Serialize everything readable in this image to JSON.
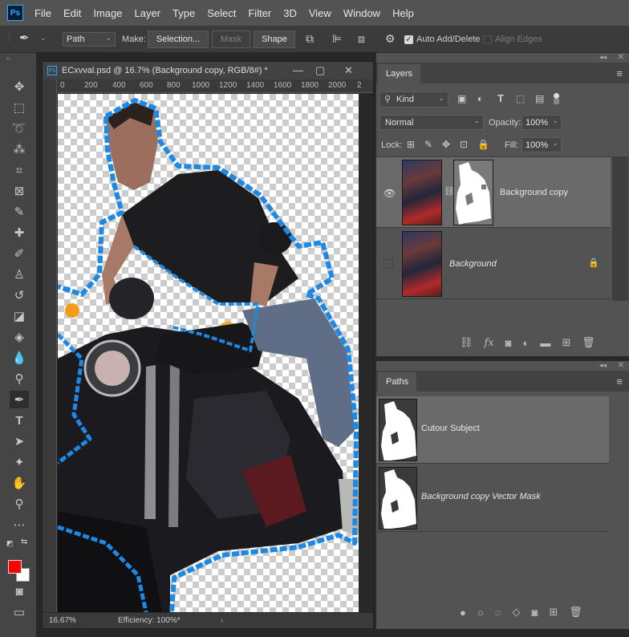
{
  "app": {
    "logo": "Ps"
  },
  "menu": [
    "File",
    "Edit",
    "Image",
    "Layer",
    "Type",
    "Select",
    "Filter",
    "3D",
    "View",
    "Window",
    "Help"
  ],
  "options": {
    "mode_value": "Path",
    "make_label": "Make:",
    "selection_btn": "Selection...",
    "mask_btn": "Mask",
    "shape_btn": "Shape",
    "auto_add_delete": "Auto Add/Delete",
    "align_edges": "Align Edges"
  },
  "tools": [
    "move-icon",
    "marquee-icon",
    "lasso-icon",
    "quick-select-icon",
    "crop-icon",
    "frame-icon",
    "eyedropper-icon",
    "healing-icon",
    "brush-icon",
    "stamp-icon",
    "history-brush-icon",
    "eraser-icon",
    "paint-bucket-icon",
    "blur-icon",
    "dodge-icon",
    "pen-icon",
    "type-icon",
    "path-select-icon",
    "custom-shape-icon",
    "hand-icon",
    "zoom-icon",
    "more-tools-icon"
  ],
  "colors": {
    "foreground": "#ff0000",
    "background": "#ffffff",
    "path_blue": "#1e88e5"
  },
  "document": {
    "title": "ECxvval.psd @ 16.7% (Background copy, RGB/8#) *",
    "ruler_top": [
      "0",
      "200",
      "400",
      "600",
      "800",
      "1000",
      "1200",
      "1400",
      "1600",
      "1800",
      "2000",
      "2"
    ],
    "zoom": "16.67%",
    "efficiency": "Efficiency: 100%*"
  },
  "layers_panel": {
    "tab": "Layers",
    "kind_label": "Kind",
    "blend_mode": "Normal",
    "opacity_label": "Opacity:",
    "opacity_value": "100%",
    "lock_label": "Lock:",
    "fill_label": "Fill:",
    "fill_value": "100%",
    "layers": [
      {
        "name": "Background copy",
        "visible": true,
        "selected": true
      },
      {
        "name": "Background",
        "visible": false,
        "selected": false
      }
    ]
  },
  "paths_panel": {
    "tab": "Paths",
    "paths": [
      {
        "name": "Cutour Subject",
        "selected": true
      },
      {
        "name": "Background copy Vector Mask",
        "selected": false
      }
    ]
  }
}
